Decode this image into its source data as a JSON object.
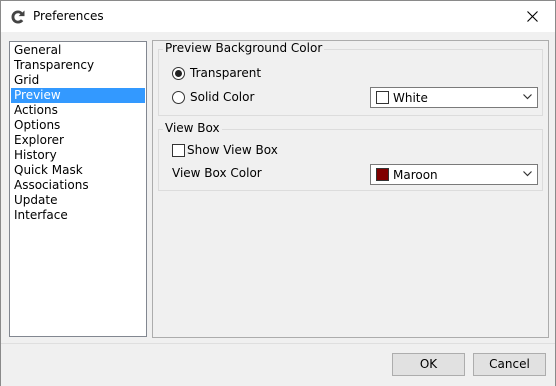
{
  "window": {
    "title": "Preferences",
    "app_icon": "gimp-icon",
    "close_icon": "close-icon"
  },
  "sidebar": {
    "selected": "Preview",
    "items": [
      {
        "label": "General"
      },
      {
        "label": "Transparency"
      },
      {
        "label": "Grid"
      },
      {
        "label": "Preview"
      },
      {
        "label": "Actions"
      },
      {
        "label": "Options"
      },
      {
        "label": "Explorer"
      },
      {
        "label": "History"
      },
      {
        "label": "Quick Mask"
      },
      {
        "label": "Associations"
      },
      {
        "label": "Update"
      },
      {
        "label": "Interface"
      }
    ]
  },
  "preview_bg": {
    "group_title": "Preview Background Color",
    "transparent_label": "Transparent",
    "transparent_checked": true,
    "solid_label": "Solid Color",
    "solid_checked": false,
    "color_value": "White",
    "color_hex": "#ffffff"
  },
  "view_box": {
    "group_title": "View Box",
    "show_label": "Show View Box",
    "show_checked": false,
    "color_label": "View Box Color",
    "color_value": "Maroon",
    "color_hex": "#800000"
  },
  "footer": {
    "ok_label": "OK",
    "cancel_label": "Cancel"
  },
  "colors": {
    "selection": "#3399ff",
    "button_bg": "#e1e1e1",
    "window_bg": "#f0f0f0"
  }
}
